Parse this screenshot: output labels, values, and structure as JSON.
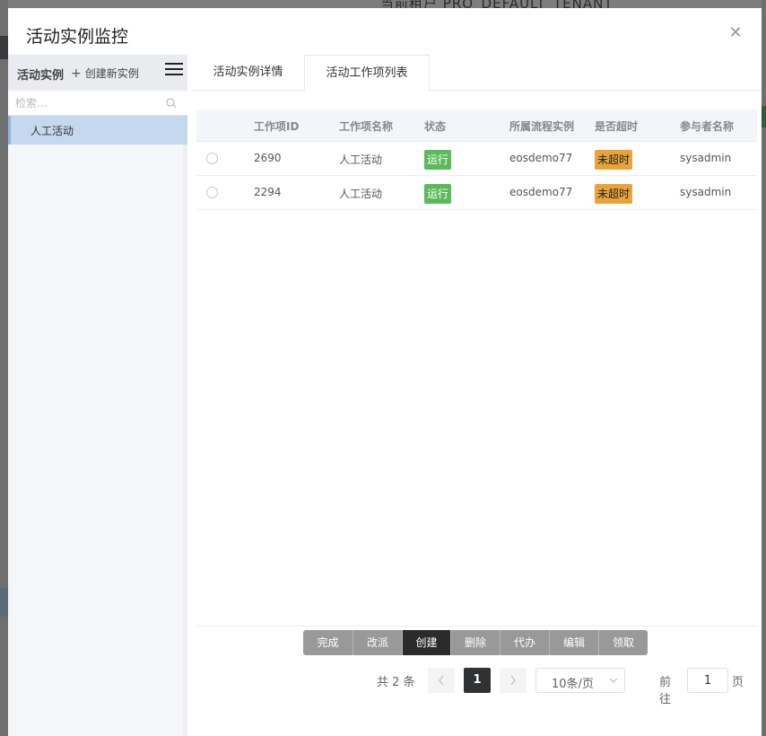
{
  "background": {
    "top_text": "当前租户 PRO_DEFAULT_TENANT"
  },
  "modal": {
    "title": "活动实例监控",
    "close_icon": "close-icon"
  },
  "sidebar": {
    "title": "活动实例",
    "create_label": "创建新实例",
    "search_placeholder": "检索...",
    "items": [
      {
        "label": "人工活动",
        "selected": true
      }
    ]
  },
  "tabs": [
    {
      "label": "活动实例详情",
      "active": false
    },
    {
      "label": "活动工作项列表",
      "active": true
    }
  ],
  "table": {
    "columns": [
      "工作项ID",
      "工作项名称",
      "状态",
      "所属流程实例",
      "是否超时",
      "参与者名称"
    ],
    "rows": [
      {
        "id": "2690",
        "name": "人工活动",
        "status": "运行",
        "process": "eosdemo77",
        "timeout": "未超时",
        "participant": "sysadmin"
      },
      {
        "id": "2294",
        "name": "人工活动",
        "status": "运行",
        "process": "eosdemo77",
        "timeout": "未超时",
        "participant": "sysadmin"
      }
    ]
  },
  "actions": [
    {
      "label": "完成",
      "active": false
    },
    {
      "label": "改派",
      "active": false
    },
    {
      "label": "创建",
      "active": true
    },
    {
      "label": "删除",
      "active": false
    },
    {
      "label": "代办",
      "active": false
    },
    {
      "label": "编辑",
      "active": false
    },
    {
      "label": "领取",
      "active": false
    }
  ],
  "pagination": {
    "total_text": "共 2 条",
    "current_page": "1",
    "page_size": "10条/页",
    "goto_label": "前往",
    "goto_value": "1",
    "goto_unit": "页"
  },
  "colors": {
    "status_running": "#5cb85c",
    "timeout_badge": "#e8a33b",
    "active_action": "#2b2b2b",
    "selected_item": "#c5d8ee"
  }
}
